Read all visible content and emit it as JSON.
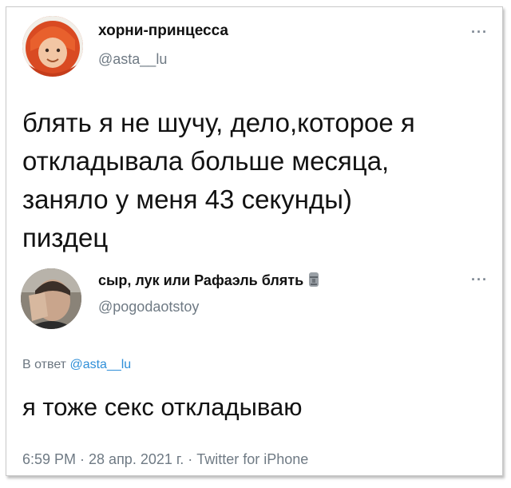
{
  "tweet": {
    "author_name": "хорни-принцесса",
    "author_handle": "@asta__lu",
    "text_lines": [
      "блять я не шучу, дело,которое я",
      "откладывала больше месяца,",
      "заняло у меня 43 секунды)",
      "пиздец"
    ],
    "more_label": "···"
  },
  "reply": {
    "author_name": "сыр, лук или Рафаэль блять",
    "author_emoji_icon": "moai-icon",
    "author_handle": "@pogodaotstoy",
    "more_label": "···",
    "reply_to_prefix": "В ответ",
    "reply_to_handle": "@asta__lu",
    "text": "я тоже секс откладываю",
    "meta": "6:59 PM · 28 апр. 2021 г. · Twitter for iPhone"
  },
  "colors": {
    "link": "#2f8fd8",
    "secondary_text": "#6f7a84",
    "avatar1_bg": "#d94a22"
  }
}
